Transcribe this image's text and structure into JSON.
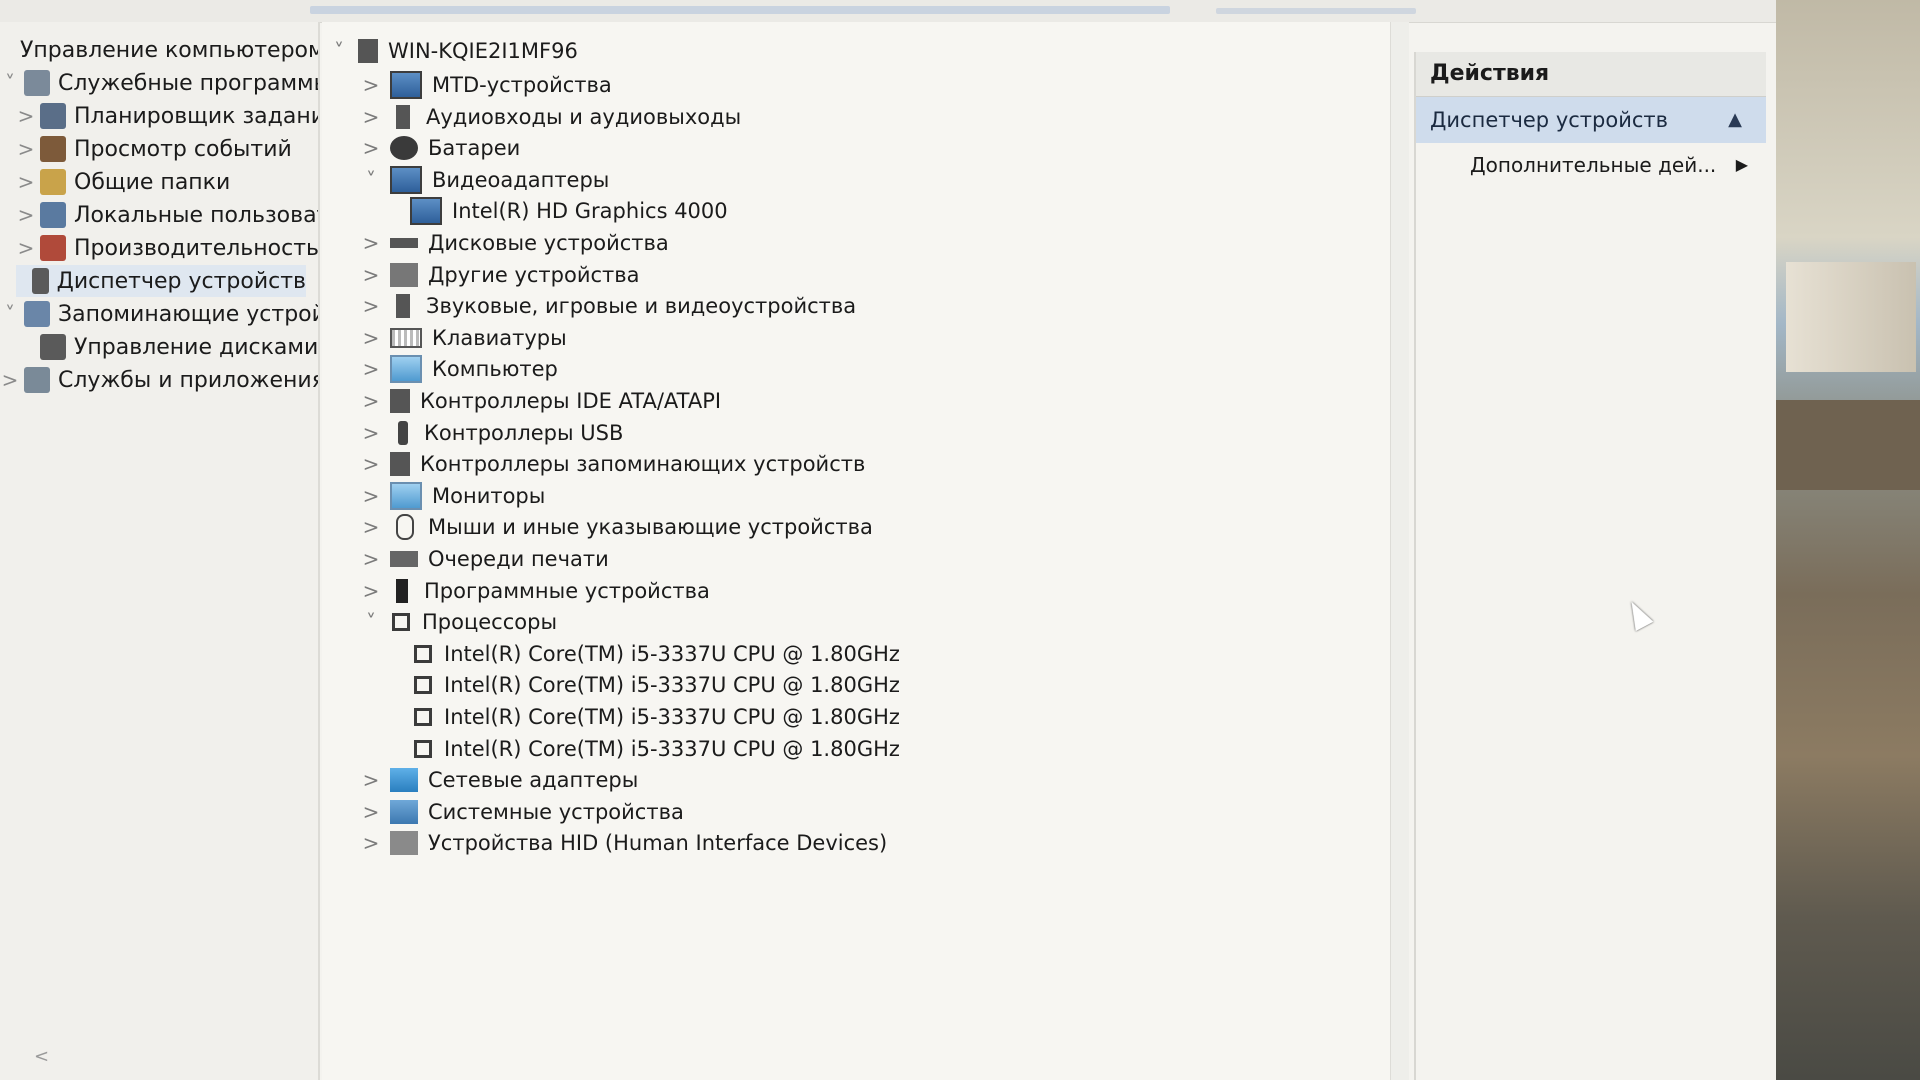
{
  "nav": {
    "items": [
      {
        "label": "Управление компьютером (л",
        "level": 0,
        "chevron": "",
        "icon": "computer-management-icon"
      },
      {
        "label": "Служебные программы",
        "level": 1,
        "chevron": "˅",
        "icon": "tools-icon"
      },
      {
        "label": "Планировщик заданий",
        "level": 2,
        "chevron": ">",
        "icon": "clock-icon"
      },
      {
        "label": "Просмотр событий",
        "level": 2,
        "chevron": ">",
        "icon": "event-viewer-icon"
      },
      {
        "label": "Общие папки",
        "level": 2,
        "chevron": ">",
        "icon": "shared-folder-icon"
      },
      {
        "label": "Локальные пользовате",
        "level": 2,
        "chevron": ">",
        "icon": "users-icon"
      },
      {
        "label": "Производительность",
        "level": 2,
        "chevron": ">",
        "icon": "performance-icon"
      },
      {
        "label": "Диспетчер устройств",
        "level": 2,
        "chevron": "",
        "icon": "device-manager-icon",
        "selected": true
      },
      {
        "label": "Запоминающие устройст",
        "level": 1,
        "chevron": "˅",
        "icon": "storage-icon"
      },
      {
        "label": "Управление дисками",
        "level": 2,
        "chevron": "",
        "icon": "disk-management-icon"
      },
      {
        "label": "Службы и приложения",
        "level": 1,
        "chevron": ">",
        "icon": "services-icon"
      }
    ],
    "scroll_left": "<",
    "scroll_right": ">"
  },
  "tree": {
    "root": "WIN-KQIE2I1MF96",
    "rows": [
      {
        "label": "MTD-устройства",
        "chevron": ">",
        "icon": "screen",
        "indent": 1
      },
      {
        "label": "Аудиовходы и аудиовыходы",
        "chevron": ">",
        "icon": "snd",
        "indent": 1
      },
      {
        "label": "Батареи",
        "chevron": ">",
        "icon": "bat",
        "indent": 1
      },
      {
        "label": "Видеоадаптеры",
        "chevron": "˅",
        "icon": "screen",
        "indent": 1
      },
      {
        "label": "Intel(R) HD Graphics 4000",
        "chevron": "",
        "icon": "screen",
        "indent": 2
      },
      {
        "label": "Дисковые устройства",
        "chevron": ">",
        "icon": "disk",
        "indent": 1
      },
      {
        "label": "Другие устройства",
        "chevron": ">",
        "icon": "other",
        "indent": 1
      },
      {
        "label": "Звуковые, игровые и видеоустройства",
        "chevron": ">",
        "icon": "snd",
        "indent": 1
      },
      {
        "label": "Клавиатуры",
        "chevron": ">",
        "icon": "kbd",
        "indent": 1
      },
      {
        "label": "Компьютер",
        "chevron": ">",
        "icon": "pc",
        "indent": 1
      },
      {
        "label": "Контроллеры IDE ATA/ATAPI",
        "chevron": ">",
        "icon": "comp",
        "indent": 1
      },
      {
        "label": "Контроллеры USB",
        "chevron": ">",
        "icon": "usb",
        "indent": 1
      },
      {
        "label": "Контроллеры запоминающих устройств",
        "chevron": ">",
        "icon": "comp",
        "indent": 1
      },
      {
        "label": "Мониторы",
        "chevron": ">",
        "icon": "pc",
        "indent": 1
      },
      {
        "label": "Мыши и иные указывающие устройства",
        "chevron": ">",
        "icon": "mouse",
        "indent": 1
      },
      {
        "label": "Очереди печати",
        "chevron": ">",
        "icon": "printer",
        "indent": 1
      },
      {
        "label": "Программные устройства",
        "chevron": ">",
        "icon": "fw",
        "indent": 1
      },
      {
        "label": "Процессоры",
        "chevron": "˅",
        "icon": "chip",
        "indent": 1
      },
      {
        "label": "Intel(R) Core(TM) i5-3337U CPU @ 1.80GHz",
        "chevron": "",
        "icon": "chip",
        "indent": 2
      },
      {
        "label": "Intel(R) Core(TM) i5-3337U CPU @ 1.80GHz",
        "chevron": "",
        "icon": "chip",
        "indent": 2
      },
      {
        "label": "Intel(R) Core(TM) i5-3337U CPU @ 1.80GHz",
        "chevron": "",
        "icon": "chip",
        "indent": 2
      },
      {
        "label": "Intel(R) Core(TM) i5-3337U CPU @ 1.80GHz",
        "chevron": "",
        "icon": "chip",
        "indent": 2
      },
      {
        "label": "Сетевые адаптеры",
        "chevron": ">",
        "icon": "net",
        "indent": 1
      },
      {
        "label": "Системные устройства",
        "chevron": ">",
        "icon": "sys",
        "indent": 1
      },
      {
        "label": "Устройства HID (Human Interface Devices)",
        "chevron": ">",
        "icon": "hid",
        "indent": 1
      }
    ]
  },
  "actions": {
    "title": "Действия",
    "header": "Диспетчер устройств",
    "header_caret": "▲",
    "more": "Дополнительные дей...",
    "more_caret": "▶"
  },
  "colors": {
    "selection": "#dfe7f0",
    "actions_header": "#cfdcec",
    "tree_background": "#f7f6f2"
  }
}
